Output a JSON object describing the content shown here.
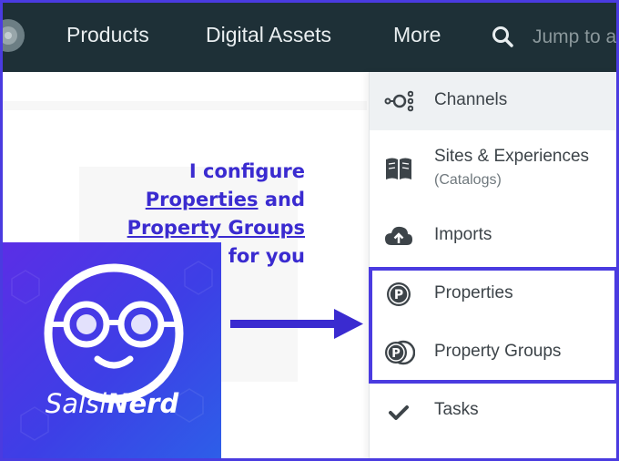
{
  "nav": {
    "items": [
      "Products",
      "Digital Assets",
      "More"
    ],
    "search_placeholder": "Jump to a",
    "colors": {
      "background": "#1e3037",
      "text": "#e9eef0"
    },
    "icons": [
      "app-logo-icon",
      "search-icon"
    ]
  },
  "caption": {
    "line1": "I configure",
    "properties_link": "Properties",
    "and_word": " and",
    "property_groups_link": "Property Groups",
    "line4": "for you",
    "color": "#3a2bd0"
  },
  "badge": {
    "name_regular": "Salsi",
    "name_bold": "Nerd",
    "icon": "nerd-face-logo"
  },
  "menu": {
    "items": [
      {
        "label": "Channels",
        "icon": "channels-icon"
      },
      {
        "label": "Sites & Experiences",
        "sublabel": "(Catalogs)",
        "icon": "book-icon"
      },
      {
        "label": "Imports",
        "icon": "cloud-upload-icon"
      },
      {
        "label": "Properties",
        "icon": "property-icon"
      },
      {
        "label": "Property Groups",
        "icon": "property-groups-icon"
      },
      {
        "label": "Tasks",
        "icon": "checkmark-icon"
      }
    ],
    "highlight_color": "#4a3be0"
  }
}
